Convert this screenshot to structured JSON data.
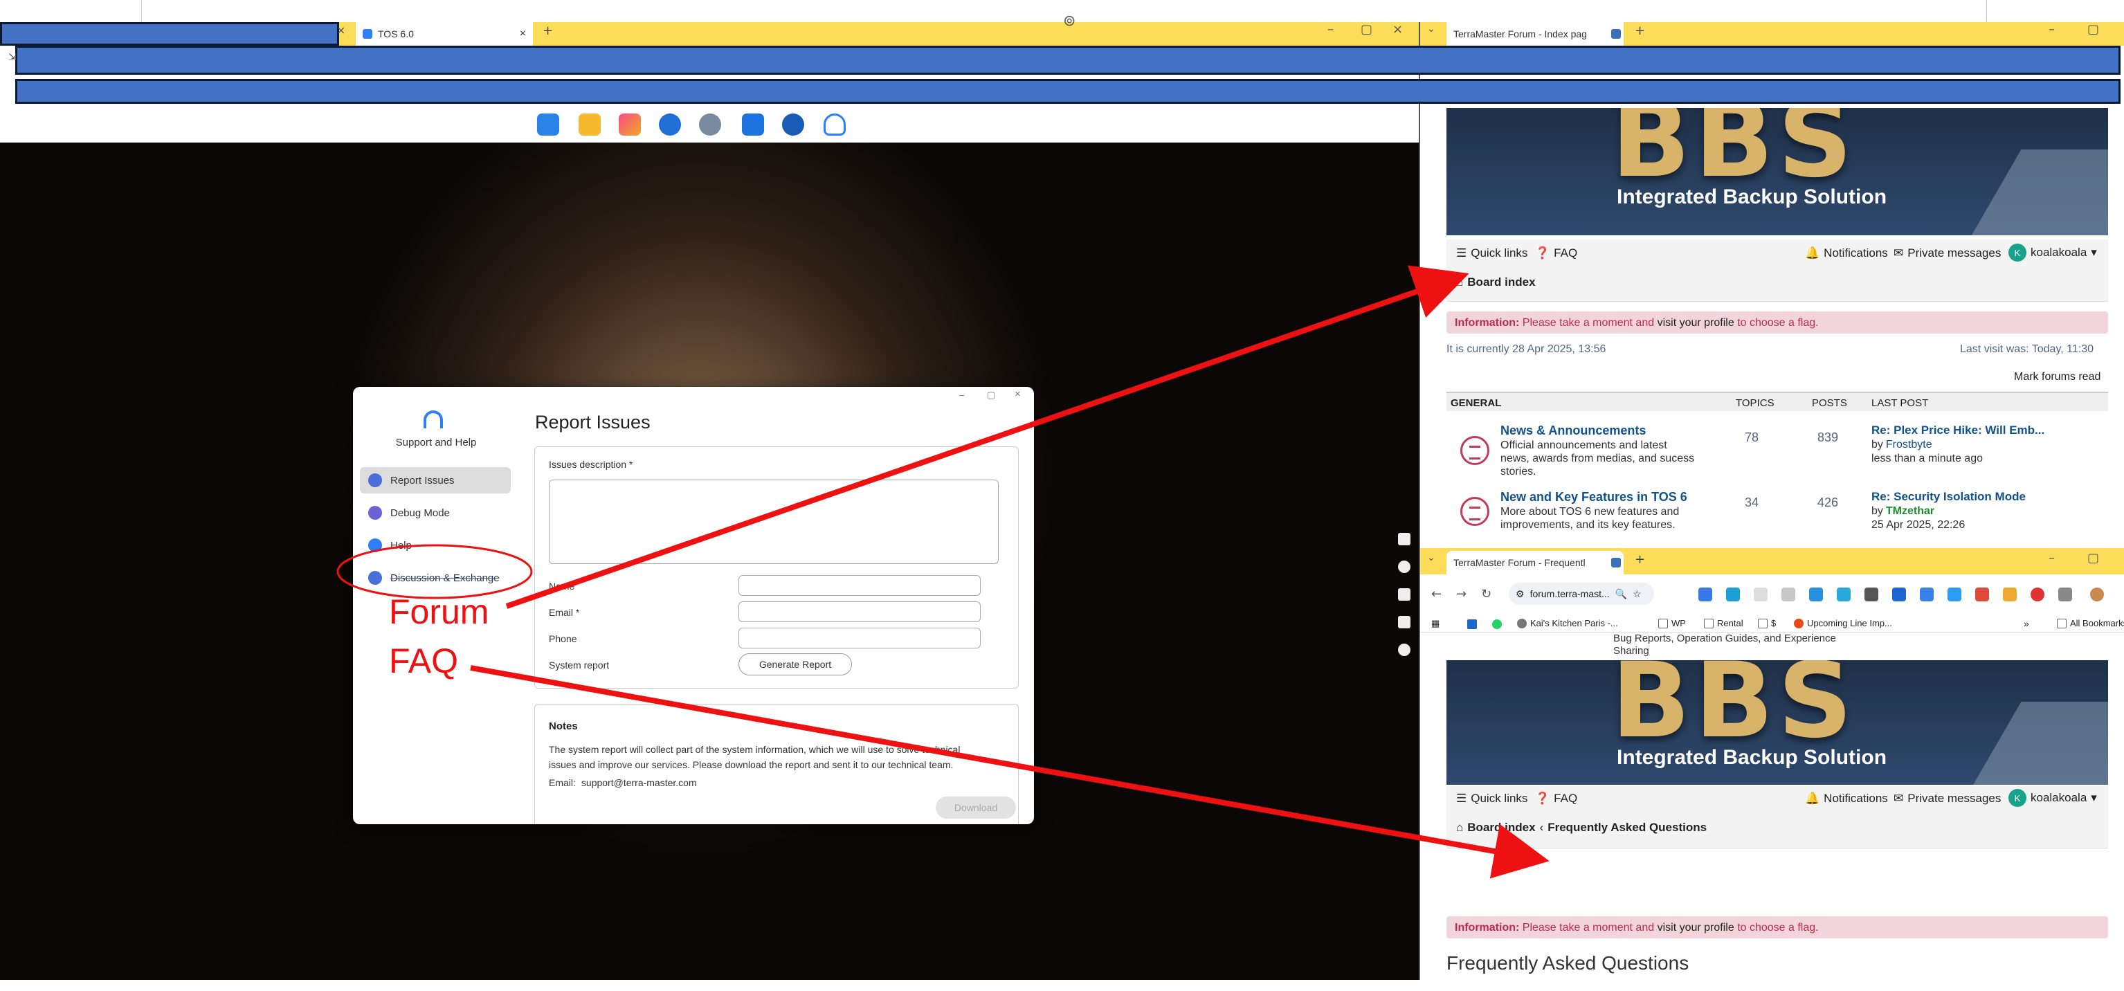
{
  "tos_window": {
    "tab_title": "TOS 6.0",
    "dock_icons": [
      "control-panel-icon",
      "files-icon",
      "app-center-icon",
      "clock-icon",
      "settings-icon",
      "mail-icon",
      "docker-icon",
      "support-icon"
    ]
  },
  "dialog": {
    "sidebar_title": "Support and Help",
    "nav": [
      {
        "label": "Report Issues",
        "icon": "report-icon"
      },
      {
        "label": "Debug Mode",
        "icon": "debug-icon"
      },
      {
        "label": "Help",
        "icon": "help-icon"
      },
      {
        "label": "Discussion & Exchange",
        "icon": "discussion-icon"
      }
    ],
    "title": "Report Issues",
    "desc_label": "Issues description *",
    "fields": [
      {
        "label": "Name"
      },
      {
        "label": "Email *"
      },
      {
        "label": "Phone"
      }
    ],
    "system_report_label": "System report",
    "generate_button": "Generate Report",
    "notes_title": "Notes",
    "notes_text_1": "The system report will collect part of the system information, which we will use to solve technical",
    "notes_text_2": "issues and improve our services. Please download the report and sent it to our technical team.",
    "email_label": "Email:",
    "email_value": "support@terra-master.com",
    "download_button": "Download"
  },
  "annotations": {
    "forum_label": "Forum",
    "faq_label": "FAQ",
    "arrow_color": "#ee1111"
  },
  "forum_top": {
    "tab_title": "TerraMaster Forum - Index pag",
    "banner_big": "BBS",
    "banner_small": "Integrated Backup Solution",
    "quick_links": "Quick links",
    "faq": "FAQ",
    "notifications": "Notifications",
    "private_messages": "Private messages",
    "username": "koalakoala",
    "avatar_letter": "K",
    "breadcrumb": "Board index",
    "info_label": "Information:",
    "info_a": "Please take a moment and",
    "info_link": "visit your profile",
    "info_b": "to choose a flag.",
    "current_time": "It is currently 28 Apr 2025, 13:56",
    "last_visit": "Last visit was: Today, 11:30",
    "mark_read": "Mark forums read",
    "headers": {
      "general": "GENERAL",
      "topics": "TOPICS",
      "posts": "POSTS",
      "last_post": "LAST POST"
    },
    "forums": [
      {
        "title": "News & Announcements",
        "desc1": "Official announcements and latest",
        "desc2": "news, awards from medias, and sucess",
        "desc3": "stories.",
        "topics": "78",
        "posts": "839",
        "lp_title": "Re: Plex Price Hike: Will Emb...",
        "lp_by": "by",
        "lp_user": "Frostbyte",
        "lp_date": "less than a minute ago"
      },
      {
        "title": "New and Key Features in TOS 6",
        "desc1": "More about TOS 6 new features and",
        "desc2": "improvements, and its key features.",
        "topics": "34",
        "posts": "426",
        "lp_title": "Re: Security Isolation Mode",
        "lp_by": "by",
        "lp_user": "TMzethar",
        "lp_date": "25 Apr 2025, 22:26"
      }
    ]
  },
  "forum_bottom": {
    "tab_title": "TerraMaster Forum - Frequentl",
    "url": "forum.terra-mast...",
    "bookmarks": [
      "Kai's Kitchen Paris -...",
      "WP",
      "Rental",
      "$",
      "Upcoming Line Imp..."
    ],
    "all_bookmarks": "All Bookmarks",
    "partial_text_1": "Bug Reports, Operation Guides, and Experience",
    "partial_text_2": "Sharing",
    "banner_big": "BBS",
    "banner_small": "Integrated Backup Solution",
    "quick_links": "Quick links",
    "faq": "FAQ",
    "notifications": "Notifications",
    "private_messages": "Private messages",
    "username": "koalakoala",
    "avatar_letter": "K",
    "breadcrumb_home": "Board index",
    "breadcrumb_sep": "‹",
    "breadcrumb_page": "Frequently Asked Questions",
    "info_label": "Information:",
    "info_a": "Please take a moment and",
    "info_link": "visit your profile",
    "info_b": "to choose a flag.",
    "page_heading": "Frequently Asked Questions"
  }
}
